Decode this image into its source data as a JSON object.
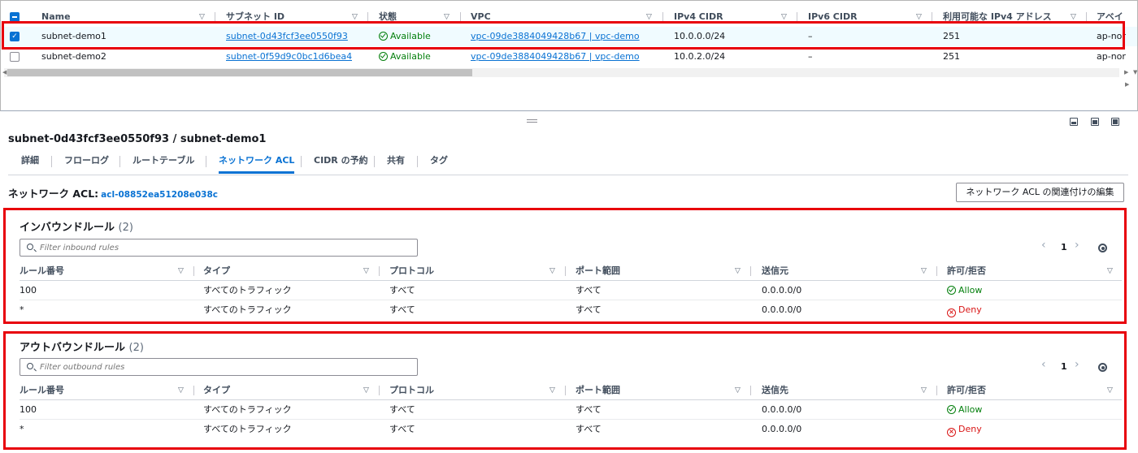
{
  "subnet_table": {
    "columns": [
      "Name",
      "サブネット ID",
      "状態",
      "VPC",
      "IPv4 CIDR",
      "IPv6 CIDR",
      "利用可能な IPv4 アドレス",
      "アベイ"
    ],
    "rows": [
      {
        "selected": true,
        "name": "subnet-demo1",
        "subnet_id": "subnet-0d43fcf3ee0550f93",
        "state": "Available",
        "vpc": "vpc-09de3884049428b67 | vpc-demo",
        "ipv4": "10.0.0.0/24",
        "ipv6": "–",
        "available_ipv4": "251",
        "az": "ap-nor"
      },
      {
        "selected": false,
        "name": "subnet-demo2",
        "subnet_id": "subnet-0f59d9c0bc1d6bea4",
        "state": "Available",
        "vpc": "vpc-09de3884049428b67 | vpc-demo",
        "ipv4": "10.0.2.0/24",
        "ipv6": "–",
        "available_ipv4": "251",
        "az": "ap-nor"
      }
    ]
  },
  "detail": {
    "title": "subnet-0d43fcf3ee0550f93 / subnet-demo1",
    "tabs": [
      "詳細",
      "フローログ",
      "ルートテーブル",
      "ネットワーク ACL",
      "CIDR の予約",
      "共有",
      "タグ"
    ],
    "active_tab": "ネットワーク ACL",
    "acl_label": "ネットワーク ACL:",
    "acl_id": "acl-08852ea51208e038c",
    "edit_button": "ネットワーク ACL の関連付けの編集"
  },
  "inbound": {
    "title": "インバウンドルール",
    "count": "(2)",
    "filter_placeholder": "Filter inbound rules",
    "page": "1",
    "columns": [
      "ルール番号",
      "タイプ",
      "プロトコル",
      "ポート範囲",
      "送信元",
      "許可/拒否"
    ],
    "rows": [
      {
        "rule": "100",
        "type": "すべてのトラフィック",
        "protocol": "すべて",
        "port": "すべて",
        "addr": "0.0.0.0/0",
        "action": "Allow"
      },
      {
        "rule": "*",
        "type": "すべてのトラフィック",
        "protocol": "すべて",
        "port": "すべて",
        "addr": "0.0.0.0/0",
        "action": "Deny"
      }
    ]
  },
  "outbound": {
    "title": "アウトバウンドルール",
    "count": "(2)",
    "filter_placeholder": "Filter outbound rules",
    "page": "1",
    "columns": [
      "ルール番号",
      "タイプ",
      "プロトコル",
      "ポート範囲",
      "送信先",
      "許可/拒否"
    ],
    "rows": [
      {
        "rule": "100",
        "type": "すべてのトラフィック",
        "protocol": "すべて",
        "port": "すべて",
        "addr": "0.0.0.0/0",
        "action": "Allow"
      },
      {
        "rule": "*",
        "type": "すべてのトラフィック",
        "protocol": "すべて",
        "port": "すべて",
        "addr": "0.0.0.0/0",
        "action": "Deny"
      }
    ]
  },
  "colors": {
    "accent": "#0972d3",
    "ok": "#037f0c",
    "deny": "#d91515",
    "highlight": "#e8000b"
  }
}
